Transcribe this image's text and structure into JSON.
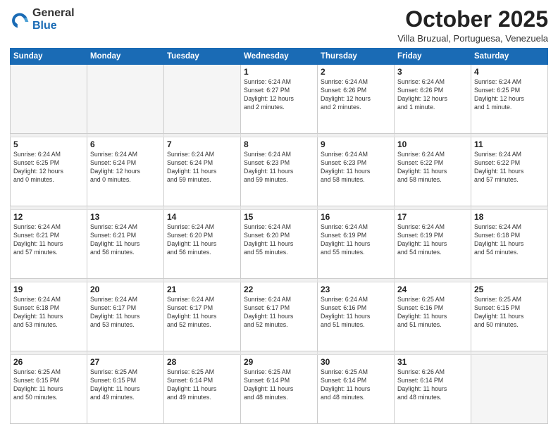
{
  "header": {
    "logo_general": "General",
    "logo_blue": "Blue",
    "month_title": "October 2025",
    "location": "Villa Bruzual, Portuguesa, Venezuela"
  },
  "weekdays": [
    "Sunday",
    "Monday",
    "Tuesday",
    "Wednesday",
    "Thursday",
    "Friday",
    "Saturday"
  ],
  "weeks": [
    [
      {
        "day": "",
        "info": ""
      },
      {
        "day": "",
        "info": ""
      },
      {
        "day": "",
        "info": ""
      },
      {
        "day": "1",
        "info": "Sunrise: 6:24 AM\nSunset: 6:27 PM\nDaylight: 12 hours\nand 2 minutes."
      },
      {
        "day": "2",
        "info": "Sunrise: 6:24 AM\nSunset: 6:26 PM\nDaylight: 12 hours\nand 2 minutes."
      },
      {
        "day": "3",
        "info": "Sunrise: 6:24 AM\nSunset: 6:26 PM\nDaylight: 12 hours\nand 1 minute."
      },
      {
        "day": "4",
        "info": "Sunrise: 6:24 AM\nSunset: 6:25 PM\nDaylight: 12 hours\nand 1 minute."
      }
    ],
    [
      {
        "day": "5",
        "info": "Sunrise: 6:24 AM\nSunset: 6:25 PM\nDaylight: 12 hours\nand 0 minutes."
      },
      {
        "day": "6",
        "info": "Sunrise: 6:24 AM\nSunset: 6:24 PM\nDaylight: 12 hours\nand 0 minutes."
      },
      {
        "day": "7",
        "info": "Sunrise: 6:24 AM\nSunset: 6:24 PM\nDaylight: 11 hours\nand 59 minutes."
      },
      {
        "day": "8",
        "info": "Sunrise: 6:24 AM\nSunset: 6:23 PM\nDaylight: 11 hours\nand 59 minutes."
      },
      {
        "day": "9",
        "info": "Sunrise: 6:24 AM\nSunset: 6:23 PM\nDaylight: 11 hours\nand 58 minutes."
      },
      {
        "day": "10",
        "info": "Sunrise: 6:24 AM\nSunset: 6:22 PM\nDaylight: 11 hours\nand 58 minutes."
      },
      {
        "day": "11",
        "info": "Sunrise: 6:24 AM\nSunset: 6:22 PM\nDaylight: 11 hours\nand 57 minutes."
      }
    ],
    [
      {
        "day": "12",
        "info": "Sunrise: 6:24 AM\nSunset: 6:21 PM\nDaylight: 11 hours\nand 57 minutes."
      },
      {
        "day": "13",
        "info": "Sunrise: 6:24 AM\nSunset: 6:21 PM\nDaylight: 11 hours\nand 56 minutes."
      },
      {
        "day": "14",
        "info": "Sunrise: 6:24 AM\nSunset: 6:20 PM\nDaylight: 11 hours\nand 56 minutes."
      },
      {
        "day": "15",
        "info": "Sunrise: 6:24 AM\nSunset: 6:20 PM\nDaylight: 11 hours\nand 55 minutes."
      },
      {
        "day": "16",
        "info": "Sunrise: 6:24 AM\nSunset: 6:19 PM\nDaylight: 11 hours\nand 55 minutes."
      },
      {
        "day": "17",
        "info": "Sunrise: 6:24 AM\nSunset: 6:19 PM\nDaylight: 11 hours\nand 54 minutes."
      },
      {
        "day": "18",
        "info": "Sunrise: 6:24 AM\nSunset: 6:18 PM\nDaylight: 11 hours\nand 54 minutes."
      }
    ],
    [
      {
        "day": "19",
        "info": "Sunrise: 6:24 AM\nSunset: 6:18 PM\nDaylight: 11 hours\nand 53 minutes."
      },
      {
        "day": "20",
        "info": "Sunrise: 6:24 AM\nSunset: 6:17 PM\nDaylight: 11 hours\nand 53 minutes."
      },
      {
        "day": "21",
        "info": "Sunrise: 6:24 AM\nSunset: 6:17 PM\nDaylight: 11 hours\nand 52 minutes."
      },
      {
        "day": "22",
        "info": "Sunrise: 6:24 AM\nSunset: 6:17 PM\nDaylight: 11 hours\nand 52 minutes."
      },
      {
        "day": "23",
        "info": "Sunrise: 6:24 AM\nSunset: 6:16 PM\nDaylight: 11 hours\nand 51 minutes."
      },
      {
        "day": "24",
        "info": "Sunrise: 6:25 AM\nSunset: 6:16 PM\nDaylight: 11 hours\nand 51 minutes."
      },
      {
        "day": "25",
        "info": "Sunrise: 6:25 AM\nSunset: 6:15 PM\nDaylight: 11 hours\nand 50 minutes."
      }
    ],
    [
      {
        "day": "26",
        "info": "Sunrise: 6:25 AM\nSunset: 6:15 PM\nDaylight: 11 hours\nand 50 minutes."
      },
      {
        "day": "27",
        "info": "Sunrise: 6:25 AM\nSunset: 6:15 PM\nDaylight: 11 hours\nand 49 minutes."
      },
      {
        "day": "28",
        "info": "Sunrise: 6:25 AM\nSunset: 6:14 PM\nDaylight: 11 hours\nand 49 minutes."
      },
      {
        "day": "29",
        "info": "Sunrise: 6:25 AM\nSunset: 6:14 PM\nDaylight: 11 hours\nand 48 minutes."
      },
      {
        "day": "30",
        "info": "Sunrise: 6:25 AM\nSunset: 6:14 PM\nDaylight: 11 hours\nand 48 minutes."
      },
      {
        "day": "31",
        "info": "Sunrise: 6:26 AM\nSunset: 6:14 PM\nDaylight: 11 hours\nand 48 minutes."
      },
      {
        "day": "",
        "info": ""
      }
    ]
  ]
}
